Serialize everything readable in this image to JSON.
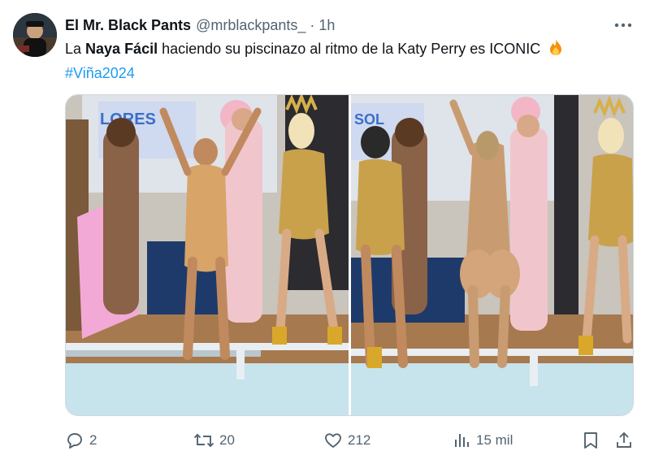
{
  "author": {
    "display_name": "El Mr. Black Pants",
    "handle": "@mrblackpants_",
    "separator": "·",
    "time": "1h",
    "avatar_icon": "avatar-image"
  },
  "post": {
    "text_before": "La ",
    "text_bold": "Naya Fácil",
    "text_after": " haciendo su piscinazo al ritmo de la Katy Perry es ICONIC",
    "emoji_icon": "fire-emoji",
    "hashtag": "#Viña2024"
  },
  "media": {
    "image_count": 2,
    "banner_text_left": "LORES",
    "banner_text_right": "SOL"
  },
  "actions": {
    "replies": "2",
    "reposts": "20",
    "likes": "212",
    "views": "15 mil"
  },
  "colors": {
    "text_primary": "#0f1419",
    "text_secondary": "#536471",
    "link": "#1d9bf0",
    "border": "#cfd9de"
  }
}
